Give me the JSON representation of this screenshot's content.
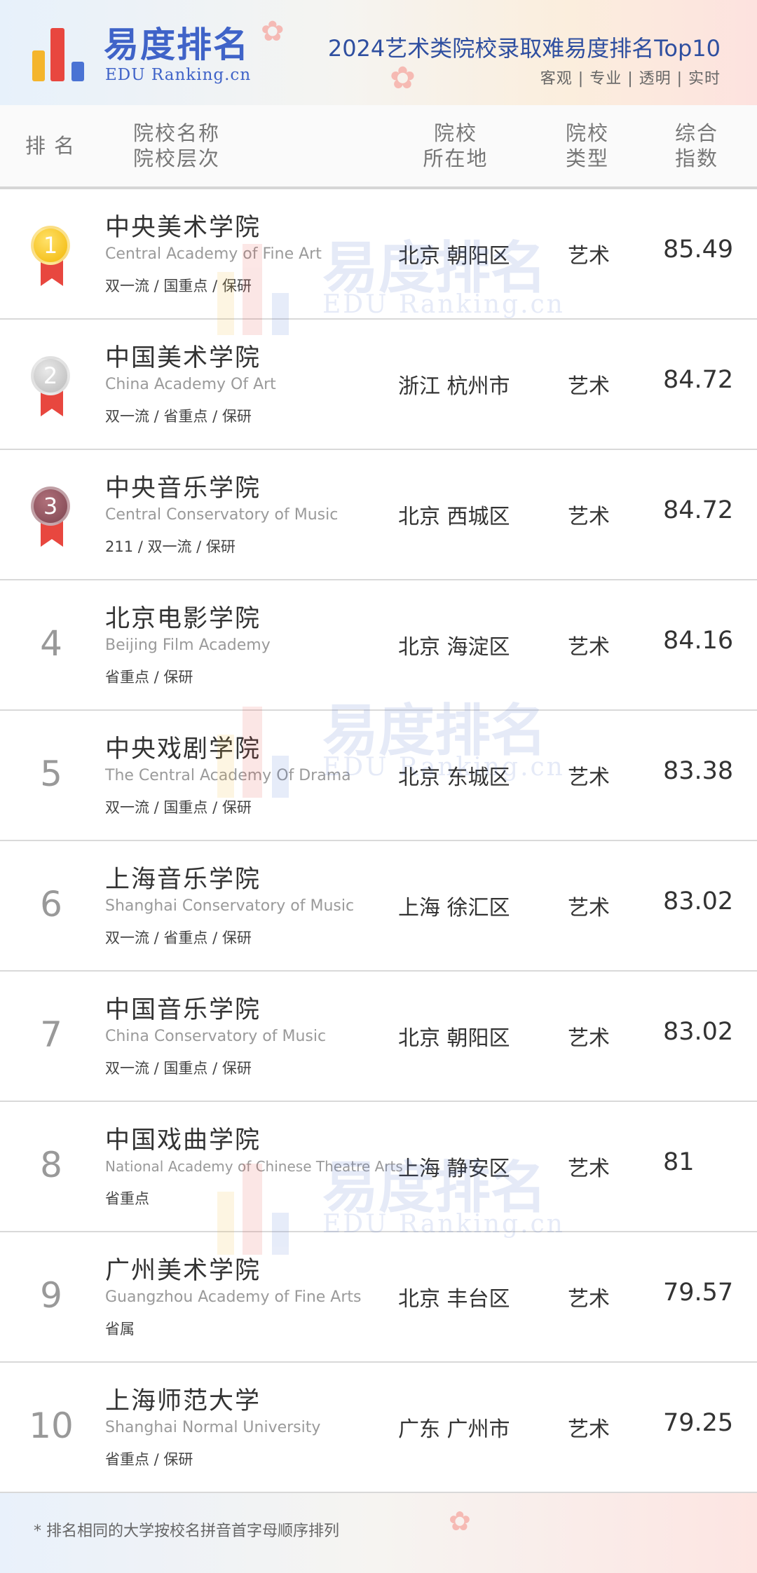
{
  "header": {
    "brand_cn": "易度排名",
    "brand_en": "EDU Ranking.cn",
    "title": "2024艺术类院校录取难易度排名Top10",
    "tags": "客观 | 专业 | 透明 | 实时",
    "brand_colors": {
      "blue": "#3f63c8",
      "yellow": "#f4b52c",
      "red": "#e8473f"
    }
  },
  "columns": {
    "rank": "排名",
    "name_1": "院校名称",
    "name_2": "院校层次",
    "loc_1": "院校",
    "loc_2": "所在地",
    "type_1": "院校",
    "type_2": "类型",
    "idx_1": "综合",
    "idx_2": "指数"
  },
  "rows": [
    {
      "rank": "1",
      "medal": "gold",
      "name": "中央美术学院",
      "en": "Central Academy of Fine Art",
      "level": "双一流 / 国重点 / 保研",
      "location": "北京 朝阳区",
      "type": "艺术",
      "index": "85.49"
    },
    {
      "rank": "2",
      "medal": "silver",
      "name": "中国美术学院",
      "en": "China Academy Of Art",
      "level": "双一流 / 省重点 / 保研",
      "location": "浙江 杭州市",
      "type": "艺术",
      "index": "84.72"
    },
    {
      "rank": "3",
      "medal": "bronze",
      "name": "中央音乐学院",
      "en": "Central Conservatory of Music",
      "level": "211 / 双一流 / 保研",
      "location": "北京 西城区",
      "type": "艺术",
      "index": "84.72"
    },
    {
      "rank": "4",
      "name": "北京电影学院",
      "en": "Beijing Film Academy",
      "level": "省重点 / 保研",
      "location": "北京 海淀区",
      "type": "艺术",
      "index": "84.16"
    },
    {
      "rank": "5",
      "name": "中央戏剧学院",
      "en": "The Central Academy Of Drama",
      "level": "双一流 / 国重点 / 保研",
      "location": "北京 东城区",
      "type": "艺术",
      "index": "83.38"
    },
    {
      "rank": "6",
      "name": "上海音乐学院",
      "en": "Shanghai Conservatory of Music",
      "level": "双一流 / 省重点 / 保研",
      "location": "上海 徐汇区",
      "type": "艺术",
      "index": "83.02"
    },
    {
      "rank": "7",
      "name": "中国音乐学院",
      "en": "China Conservatory of Music",
      "level": "双一流 / 国重点 / 保研",
      "location": "北京 朝阳区",
      "type": "艺术",
      "index": "83.02"
    },
    {
      "rank": "8",
      "name": "中国戏曲学院",
      "en": "National Academy of Chinese Theatre Arts",
      "level": "省重点",
      "location": "上海 静安区",
      "type": "艺术",
      "index": "81"
    },
    {
      "rank": "9",
      "name": "广州美术学院",
      "en": "Guangzhou Academy of Fine Arts",
      "level": "省属",
      "location": "北京 丰台区",
      "type": "艺术",
      "index": "79.57"
    },
    {
      "rank": "10",
      "name": "上海师范大学",
      "en": "Shanghai Normal University",
      "level": "省重点 / 保研",
      "location": "广东 广州市",
      "type": "艺术",
      "index": "79.25"
    }
  ],
  "footer": {
    "note": "*  排名相同的大学按校名拼音首字母顺序排列"
  }
}
